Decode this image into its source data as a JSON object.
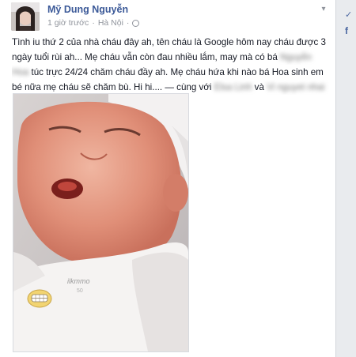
{
  "post": {
    "author": "Mỹ Dung Nguyễn",
    "time": "1 giờ trước",
    "sep": "·",
    "location": "Hà Nội",
    "lines": [
      {
        "a": "Tình iu thứ 2 của nhà cháu đây ah, tên cháu là Google hôm nay cháu được 3"
      },
      {
        "a": "ngày tuổi rùi ah... Mẹ cháu vẫn còn đau nhiều lắm, may mà có bá ",
        "blur": "Nguyễn"
      },
      {
        "blur": "Hoa",
        "a": " túc trực 24/24 chăm cháu đầy ah. Mẹ cháu hứa khi nào bá Hoa sinh em"
      },
      {
        "a": "bé nữa mẹ cháu sẽ chăm bù. Hi hi.... — cùng với ",
        "blur": "Elsa Linh",
        "b": " và ",
        "blur2": "Vi nguyet nhai"
      }
    ]
  },
  "photo": {
    "onesie_text": "ilkmmo",
    "onesie_sub": "50"
  },
  "icons": {
    "chevron": "chevron-down-icon",
    "globe": "globe-icon"
  }
}
